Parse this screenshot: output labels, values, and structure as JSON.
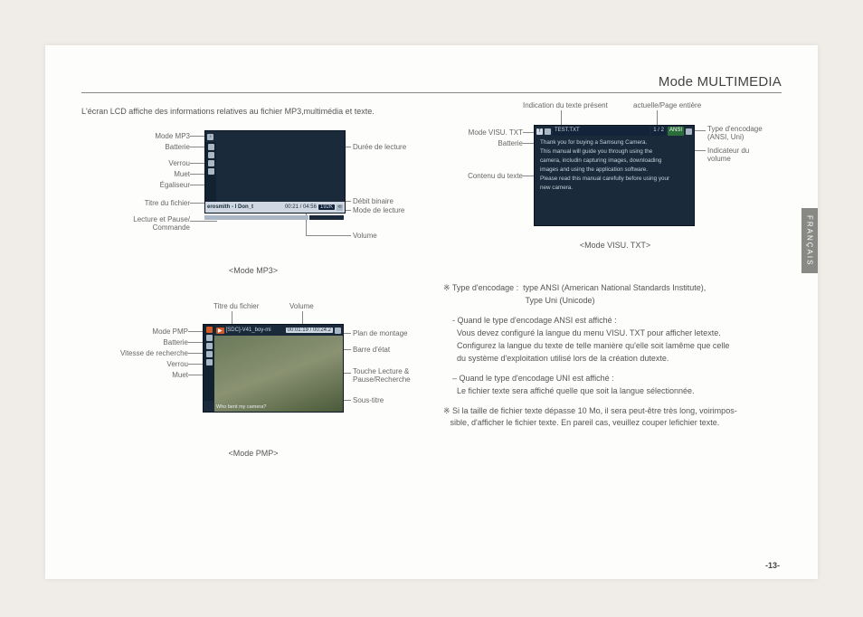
{
  "heading": "Mode MULTIMEDIA",
  "intro": "L'écran LCD affiche des informations relatives au fichier MP3,multimédia et texte.",
  "sidetab": "FRANÇAIS",
  "pagenum": "-13-",
  "mp3": {
    "caption": "<Mode MP3>",
    "labels": {
      "mode": "Mode MP3",
      "batterie": "Batterie",
      "verrou": "Verrou",
      "muet": "Muet",
      "egaliseur": "Égaliseur",
      "titre": "Titre du fichier",
      "lecture_pause": "Lecture et Pause/\nCommande",
      "duree": "Durée de lecture",
      "debit": "Débit binaire",
      "mode_lecture": "Mode de lecture",
      "volume": "Volume"
    },
    "playbar": {
      "title": "erosmith - I Don_t",
      "time": "00:21 / 04:56",
      "bitrate": "192K"
    }
  },
  "pmp": {
    "caption": "<Mode PMP>",
    "labels": {
      "titre": "Titre du fichier",
      "volume": "Volume",
      "mode": "Mode PMP",
      "batterie": "Batterie",
      "vitesse": "Vitesse de recherche",
      "verrou": "Verrou",
      "muet": "Muet",
      "plan": "Plan de montage",
      "barre": "Barre d'état",
      "touche": "Touche Lecture &\nPause/Recherche",
      "soustitre": "Sous-titre"
    },
    "topstrip": {
      "file": "[SDC]-V41_boy-mi",
      "time": "00:01:19 / 00:24:2"
    },
    "subtitle": "Who bent my camera?"
  },
  "txt": {
    "caption": "<Mode VISU. TXT>",
    "labels": {
      "indication": "Indication du texte présent",
      "actuelle": "actuelle/Page entière",
      "mode": "Mode VISU. TXT",
      "batterie": "Batterie",
      "contenu": "Contenu du texte",
      "type": "Type d'encodage\n(ANSI, Uni)",
      "indicateur": "Indicateur du\nvolume"
    },
    "title": "TEST.TXT",
    "page": "1 / 2",
    "enc": "ANSI",
    "content": [
      "Thank you for buying a Samsung Camera.",
      "This manual will guide you through using the",
      "camera, includin capturing images, downloading",
      "images and using the application software.",
      "Please read this manual carefully before using your",
      "new camera."
    ]
  },
  "body": {
    "note1_prefix": "※ Type d'encodage :",
    "note1_line1": "type ANSI (American National Standards Institute),",
    "note1_line2": "Type Uni (Unicode)",
    "ansi_title": "- Quand le type d'encodage ANSI est affiché :",
    "ansi_l1": "Vous devez configuré la langue du menu VISU. TXT pour afficher letexte.",
    "ansi_l2": "Configurez la langue du texte de telle manière qu'elle soit lamême que celle",
    "ansi_l3": "du système d'exploitation utilisé lors de la création dutexte.",
    "uni_title": "– Quand le type d'encodage UNI est affiché :",
    "uni_l1": "Le fichier texte sera affiché quelle que soit la langue sélectionnée.",
    "note2_l1": "※ Si la taille de fichier texte dépasse 10 Mo, il sera peut-être très long, voirimpos-",
    "note2_l2": "sible, d'afficher le fichier texte. En pareil cas, veuillez couper lefichier texte."
  }
}
